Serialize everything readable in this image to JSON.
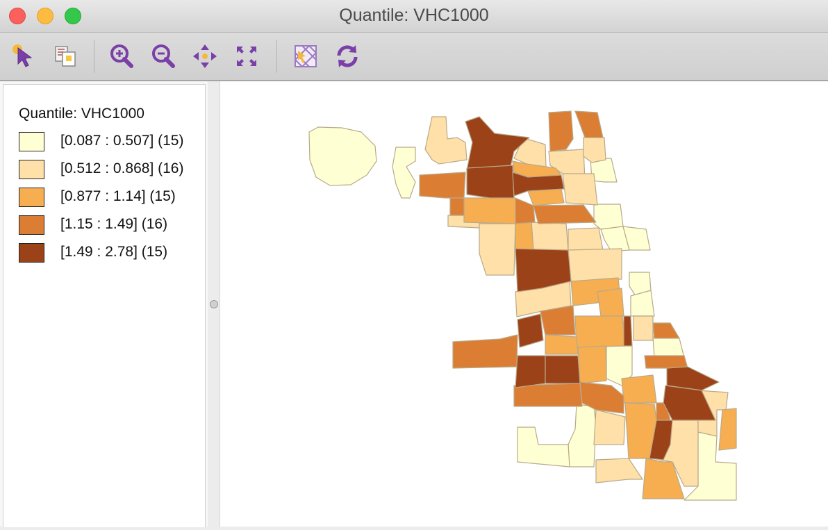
{
  "window": {
    "title": "Quantile: VHC1000"
  },
  "toolbar": {
    "buttons": [
      "select-tool",
      "copy-image",
      "zoom-in",
      "zoom-out",
      "pan",
      "fit-extent",
      "selection-shape",
      "refresh"
    ]
  },
  "legend": {
    "title": "Quantile: VHC1000",
    "items": [
      {
        "label": "[0.087 : 0.507] (15)",
        "color": "#ffffd4"
      },
      {
        "label": "[0.512 : 0.868] (16)",
        "color": "#fee0a8"
      },
      {
        "label": "[0.877 : 1.14] (15)",
        "color": "#f6ae51"
      },
      {
        "label": "[1.15 : 1.49] (16)",
        "color": "#db7e34"
      },
      {
        "label": "[1.49 : 2.78] (15)",
        "color": "#9c4219"
      }
    ]
  },
  "map": {
    "classes": 5,
    "outline_color": "#b9a98a"
  }
}
